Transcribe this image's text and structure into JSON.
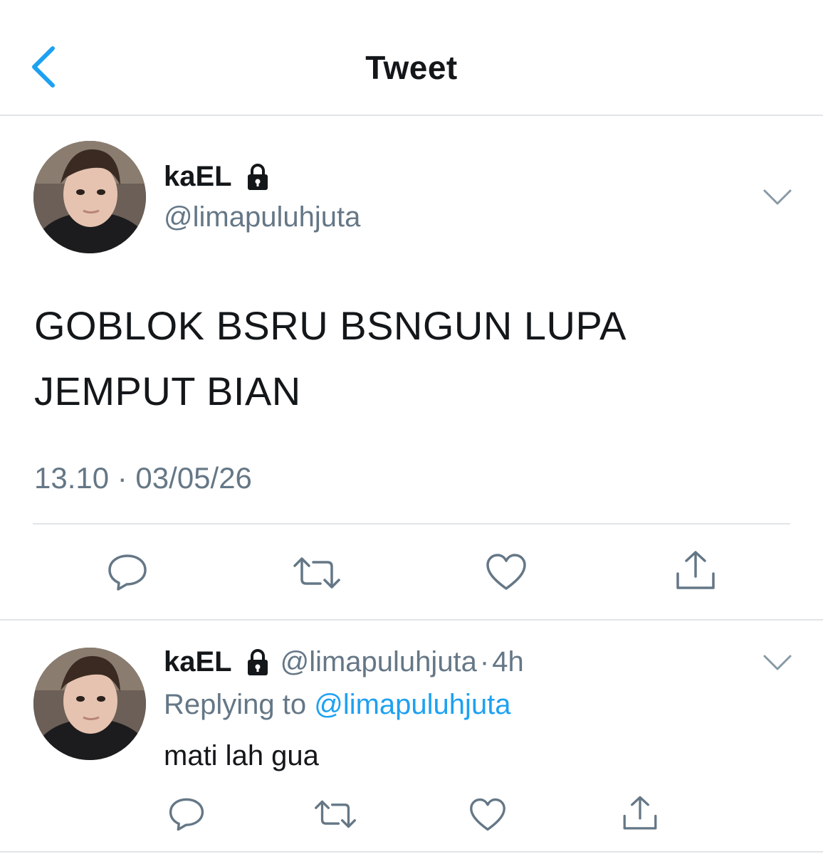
{
  "header": {
    "title": "Tweet",
    "back_icon": "chevron-left-icon",
    "accent": "#1da1f2"
  },
  "main_tweet": {
    "display_name": "kaEL",
    "handle": "@limapuluhjuta",
    "text": "GOBLOK BSRU BSNGUN LUPA JEMPUT BIAN",
    "timestamp": "13.10 · 03/05/26",
    "actions": [
      "reply-icon",
      "retweet-icon",
      "like-icon",
      "share-icon"
    ]
  },
  "reply": {
    "display_name": "kaEL",
    "handle": "@limapuluhjuta",
    "separator": "·",
    "time": "4h",
    "replying_prefix": "Replying to ",
    "replying_to": "@limapuluhjuta",
    "text": "mati lah gua",
    "actions": [
      "reply-icon",
      "retweet-icon",
      "like-icon",
      "share-icon"
    ]
  },
  "colors": {
    "text_primary": "#14171a",
    "text_secondary": "#657786",
    "link": "#1da1f2",
    "divider": "#e1e4e8"
  }
}
